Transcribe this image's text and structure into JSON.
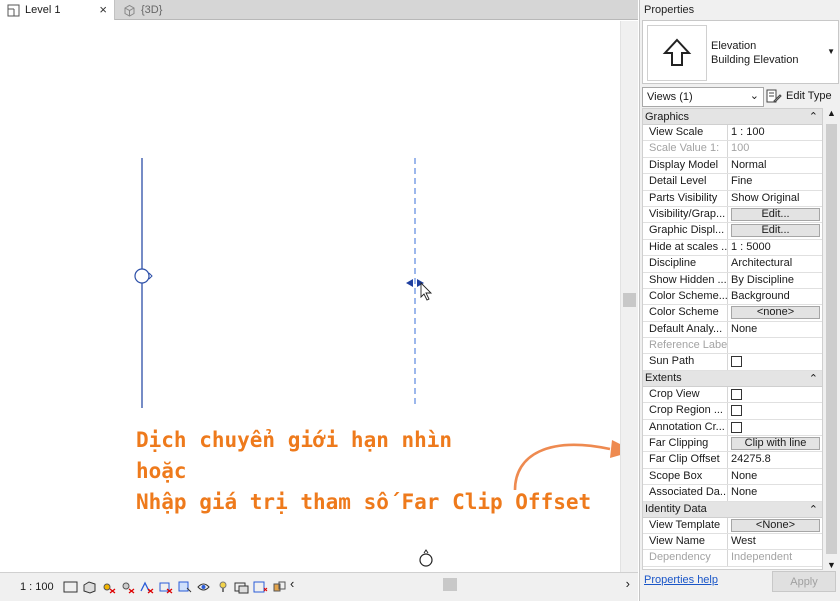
{
  "tabs": [
    {
      "label": "Level 1",
      "active": true
    },
    {
      "label": "{3D}",
      "active": false
    }
  ],
  "annotation": {
    "line1": "Dịch chuyển giới hạn nhìn",
    "line2": "hoặc",
    "line3": "Nhập giá trị tham số Far Clip Offset",
    "color": "#ee7a1c"
  },
  "status_bar": {
    "scale": "1 : 100"
  },
  "properties": {
    "title": "Properties",
    "type_line1": "Elevation",
    "type_line2": "Building Elevation",
    "views_selector": "Views (1)",
    "edit_type": "Edit Type",
    "groups": [
      {
        "name": "Graphics",
        "rows": [
          {
            "name": "View Scale",
            "value": "1 : 100",
            "kind": "text"
          },
          {
            "name": "Scale Value    1:",
            "value": "100",
            "kind": "text",
            "dim": true
          },
          {
            "name": "Display Model",
            "value": "Normal",
            "kind": "text"
          },
          {
            "name": "Detail Level",
            "value": "Fine",
            "kind": "text"
          },
          {
            "name": "Parts Visibility",
            "value": "Show Original",
            "kind": "text"
          },
          {
            "name": "Visibility/Grap...",
            "value": "Edit...",
            "kind": "button"
          },
          {
            "name": "Graphic Displ...",
            "value": "Edit...",
            "kind": "button"
          },
          {
            "name": "Hide at scales ...",
            "value": "1 : 5000",
            "kind": "text"
          },
          {
            "name": "Discipline",
            "value": "Architectural",
            "kind": "text"
          },
          {
            "name": "Show Hidden ...",
            "value": "By Discipline",
            "kind": "text"
          },
          {
            "name": "Color Scheme...",
            "value": "Background",
            "kind": "text"
          },
          {
            "name": "Color Scheme",
            "value": "<none>",
            "kind": "button"
          },
          {
            "name": "Default Analy...",
            "value": "None",
            "kind": "text"
          },
          {
            "name": "Reference Label",
            "value": "",
            "kind": "text",
            "dim": true
          },
          {
            "name": "Sun Path",
            "value": "",
            "kind": "checkbox"
          }
        ]
      },
      {
        "name": "Extents",
        "rows": [
          {
            "name": "Crop View",
            "value": "",
            "kind": "checkbox"
          },
          {
            "name": "Crop Region ...",
            "value": "",
            "kind": "checkbox"
          },
          {
            "name": "Annotation Cr...",
            "value": "",
            "kind": "checkbox"
          },
          {
            "name": "Far Clipping",
            "value": "Clip with line",
            "kind": "button"
          },
          {
            "name": "Far Clip Offset",
            "value": "24275.8",
            "kind": "text"
          },
          {
            "name": "Scope Box",
            "value": "None",
            "kind": "text"
          },
          {
            "name": "Associated Da...",
            "value": "None",
            "kind": "text"
          }
        ]
      },
      {
        "name": "Identity Data",
        "rows": [
          {
            "name": "View Template",
            "value": "<None>",
            "kind": "button"
          },
          {
            "name": "View Name",
            "value": "West",
            "kind": "text"
          },
          {
            "name": "Dependency",
            "value": "Independent",
            "kind": "text",
            "dim": true
          }
        ]
      }
    ],
    "help_link": "Properties help",
    "apply_label": "Apply"
  }
}
